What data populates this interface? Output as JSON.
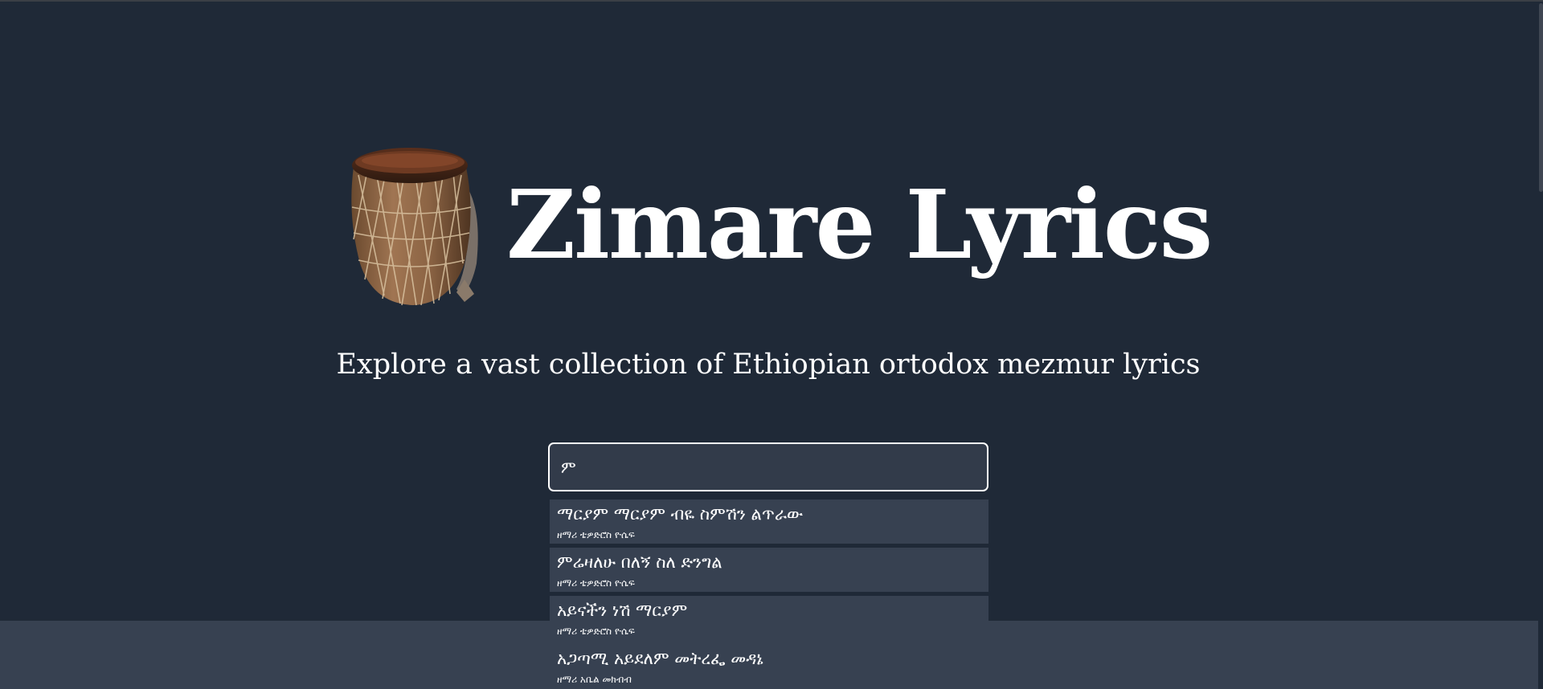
{
  "header": {
    "title": "Zimare Lyrics",
    "tagline": "Explore a vast collection of Ethiopian ortodox mezmur lyrics"
  },
  "search": {
    "value": "ም",
    "placeholder": ""
  },
  "suggestions": [
    {
      "title": "ማርያም ማርያም ብዬ ስምሽን ልጥራው",
      "artist": "ዘማሪ ቴዎድሮስ ዮሴፍ"
    },
    {
      "title": "ምሬዛለሁ በለኝ ስለ ድንግል",
      "artist": "ዘማሪ ቴዎድሮስ ዮሴፍ"
    },
    {
      "title": "አይናችን ነሽ ማርያም",
      "artist": "ዘማሪ ቴዎድሮስ ዮሴፍ"
    },
    {
      "title": "አጋጣሚ አይደለም መትረፌ መዳኔ",
      "artist": "ዘማሪ አቤል መክብብ"
    }
  ],
  "icons": {
    "logo": "kebero-drum-icon"
  },
  "colors": {
    "background": "#1f2937",
    "panel": "#374151",
    "input": "#323b4a",
    "text": "#ffffff"
  }
}
